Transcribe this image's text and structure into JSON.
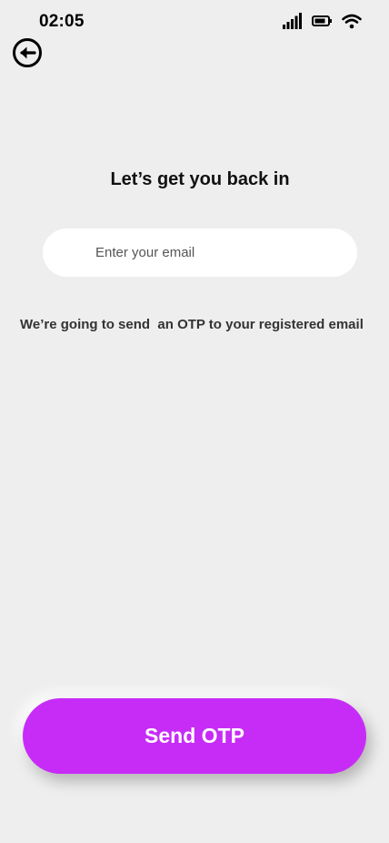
{
  "status_bar": {
    "time": "02:05",
    "icons": [
      "signal-icon",
      "battery-icon",
      "wifi-icon"
    ]
  },
  "header": {
    "back_icon": "back-arrow-icon"
  },
  "main": {
    "title": "Let’s get you back in",
    "email_placeholder": "Enter your email",
    "email_value": "",
    "info": "We’re going to send  an OTP to your registered email"
  },
  "footer": {
    "send_label": "Send OTP"
  },
  "colors": {
    "background": "#eeeeee",
    "accent": "#c72cf7",
    "input_bg": "#ffffff"
  }
}
